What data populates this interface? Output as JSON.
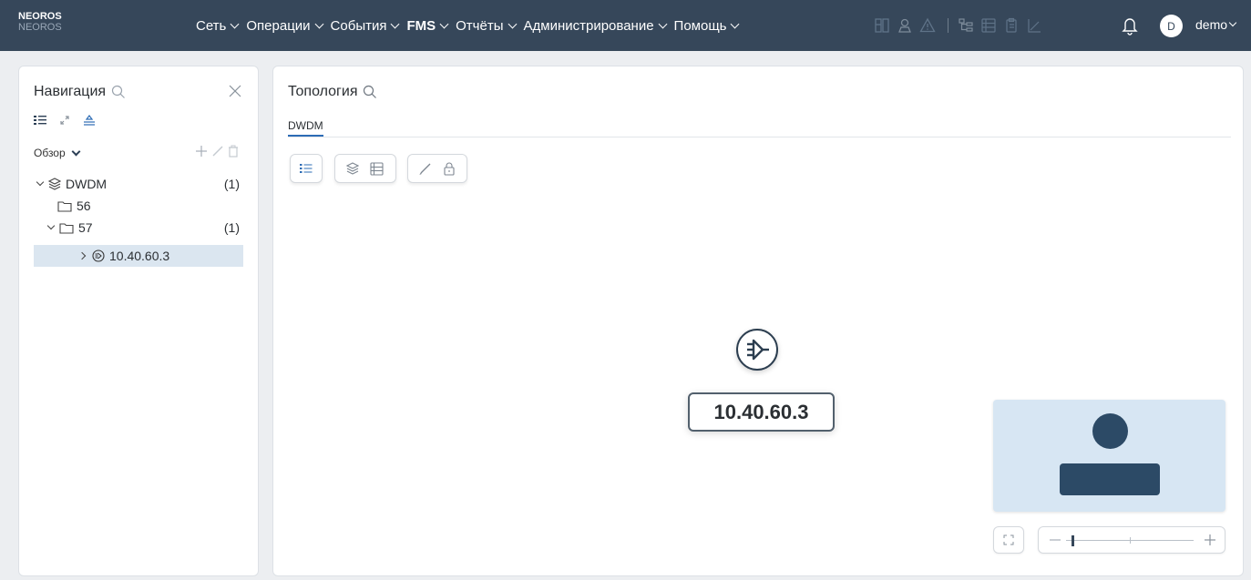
{
  "brand": {
    "name": "NEOROS",
    "subname": "NEOROS"
  },
  "menu": [
    {
      "label": "Сеть",
      "bold": false
    },
    {
      "label": "Операции",
      "bold": false
    },
    {
      "label": "События",
      "bold": false
    },
    {
      "label": "FMS",
      "bold": true
    },
    {
      "label": "Отчёты",
      "bold": false
    },
    {
      "label": "Администрирование",
      "bold": false
    },
    {
      "label": "Помощь",
      "bold": false
    }
  ],
  "user": {
    "initial": "D",
    "name": "demo"
  },
  "nav": {
    "title": "Навигация",
    "overview_label": "Обзор",
    "tree": [
      {
        "label": "DWDM",
        "count": "(1)"
      },
      {
        "label": "56",
        "count": ""
      },
      {
        "label": "57",
        "count": "(1)"
      },
      {
        "label": "10.40.60.3",
        "count": ""
      }
    ]
  },
  "topology": {
    "title": "Топология",
    "tab": "DWDM",
    "node_label": "10.40.60.3"
  },
  "zoom": {
    "level": 0.05
  },
  "colors": {
    "topbar": "#36475a",
    "accent": "#2d6cb5",
    "selected_row": "#dbe6f0",
    "minimap_bg": "#d7e6f3",
    "minimap_node": "#2c4a66"
  }
}
